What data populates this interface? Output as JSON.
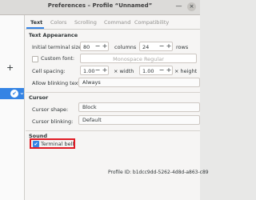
{
  "window": {
    "title": "Preferences – Profile “Unnamed”"
  },
  "titlebar": {
    "minimize_glyph": "—",
    "close_glyph": "×"
  },
  "sidebar": {
    "add_glyph": "+",
    "selected_check_glyph": "✔",
    "selected_chevron_glyph": "⌄"
  },
  "tabs": [
    {
      "label": "Text",
      "active": true
    },
    {
      "label": "Colors",
      "active": false
    },
    {
      "label": "Scrolling",
      "active": false
    },
    {
      "label": "Command",
      "active": false
    },
    {
      "label": "Compatibility",
      "active": false
    }
  ],
  "text_appearance": {
    "heading": "Text Appearance",
    "initial_size_label": "Initial terminal size:",
    "columns_value": "80",
    "columns_unit": "columns",
    "rows_value": "24",
    "rows_unit": "rows",
    "custom_font_label": "Custom font:",
    "custom_font_checked": false,
    "font_value": "Monospace Regular",
    "cell_spacing_label": "Cell spacing:",
    "width_value": "1.00",
    "width_unit": "× width",
    "height_value": "1.00",
    "height_unit": "× height",
    "blinking_label": "Allow blinking text:",
    "blinking_value": "Always"
  },
  "cursor": {
    "heading": "Cursor",
    "shape_label": "Cursor shape:",
    "shape_value": "Block",
    "blinking_label": "Cursor blinking:",
    "blinking_value": "Default"
  },
  "sound": {
    "heading": "Sound",
    "terminal_bell_label": "Terminal bell",
    "terminal_bell_checked": true
  },
  "profile_id": "Profile ID: b1dcc9dd-5262-4d8d-a863-c89",
  "colors": {
    "accent": "#3584e4",
    "highlight_box": "#e01b24"
  }
}
